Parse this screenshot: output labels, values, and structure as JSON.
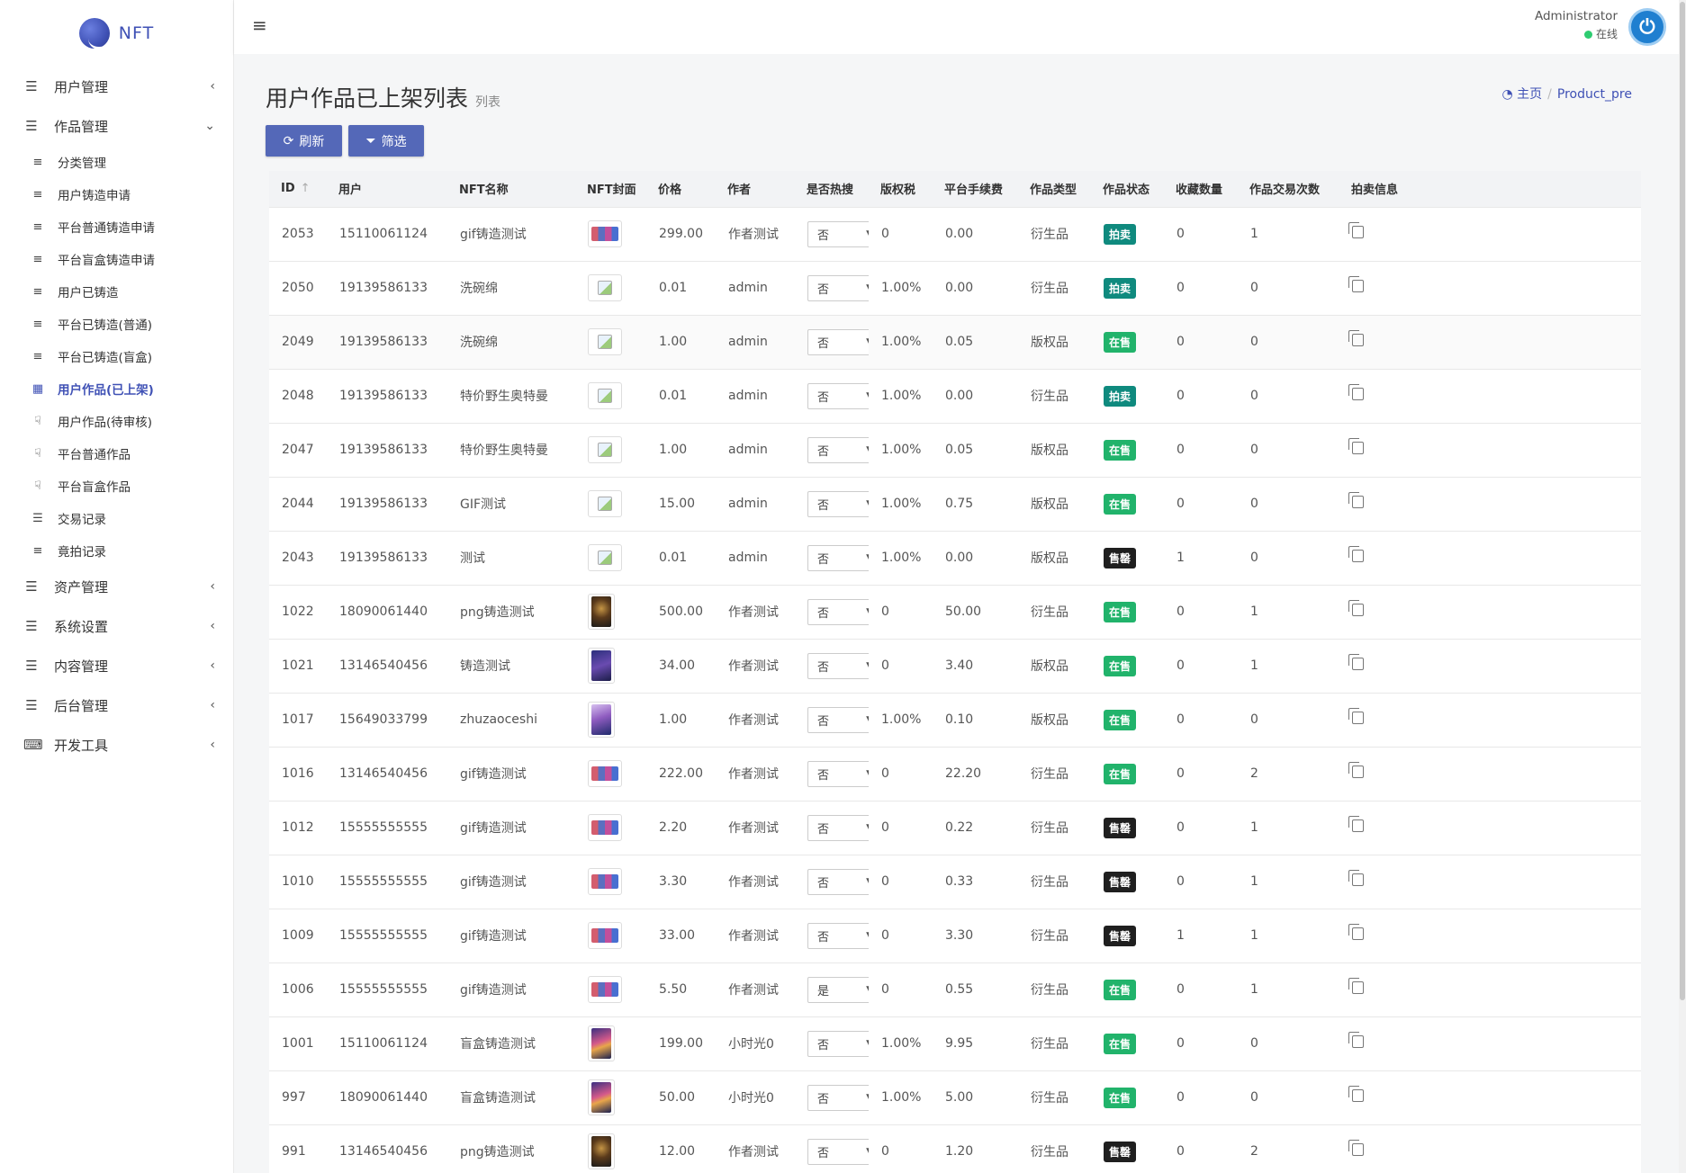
{
  "app": {
    "logo_text": "NFT"
  },
  "sidebar": {
    "groups_top": [
      {
        "label": "用户管理",
        "icon": "list-icon",
        "chevron": "‹"
      },
      {
        "label": "作品管理",
        "icon": "list-icon",
        "chevron": "⌄"
      }
    ],
    "sub_items": [
      {
        "label": "分类管理",
        "icon": "align-left-icon"
      },
      {
        "label": "用户铸造申请",
        "icon": "align-left-icon"
      },
      {
        "label": "平台普通铸造申请",
        "icon": "align-left-icon"
      },
      {
        "label": "平台盲盒铸造申请",
        "icon": "align-left-icon"
      },
      {
        "label": "用户已铸造",
        "icon": "align-left-icon"
      },
      {
        "label": "平台已铸造(普通)",
        "icon": "align-left-icon"
      },
      {
        "label": "平台已铸造(盲盒)",
        "icon": "align-left-icon"
      },
      {
        "label": "用户作品(已上架)",
        "icon": "grid-icon",
        "active": true
      },
      {
        "label": "用户作品(待审核)",
        "icon": "hand-icon"
      },
      {
        "label": "平台普通作品",
        "icon": "hand-icon"
      },
      {
        "label": "平台盲盒作品",
        "icon": "hand-icon"
      },
      {
        "label": "交易记录",
        "icon": "list-icon"
      },
      {
        "label": "竟拍记录",
        "icon": "align-left-icon"
      }
    ],
    "groups_bottom": [
      {
        "label": "资产管理",
        "icon": "list-icon",
        "chevron": "‹"
      },
      {
        "label": "系统设置",
        "icon": "list-icon",
        "chevron": "‹"
      },
      {
        "label": "内容管理",
        "icon": "list-icon",
        "chevron": "‹"
      },
      {
        "label": "后台管理",
        "icon": "list-icon",
        "chevron": "‹"
      },
      {
        "label": "开发工具",
        "icon": "keyboard-icon",
        "chevron": "‹"
      }
    ]
  },
  "header": {
    "user_name": "Administrator",
    "user_status": "在线"
  },
  "page": {
    "title": "用户作品已上架列表",
    "subtitle": "列表",
    "breadcrumb_home": "主页",
    "breadcrumb_sep": "/",
    "breadcrumb_current": "Product_pre"
  },
  "toolbar": {
    "refresh_label": "刷新",
    "filter_label": "筛选"
  },
  "table": {
    "columns": [
      "ID",
      "用户",
      "NFT名称",
      "NFT封面",
      "价格",
      "作者",
      "是否热搜",
      "版权税",
      "平台手续费",
      "作品类型",
      "作品状态",
      "收藏数量",
      "作品交易次数",
      "拍卖信息"
    ],
    "rows": [
      {
        "id": "2053",
        "user": "15110061124",
        "name": "gif铸造测试",
        "cover": "gif",
        "price": "299.00",
        "author": "作者测试",
        "hot": "否",
        "royalty": "0",
        "fee": "0.00",
        "type": "衍生品",
        "status": "拍卖",
        "fav": "0",
        "trades": "1"
      },
      {
        "id": "2050",
        "user": "19139586133",
        "name": "洗碗绵",
        "cover": "broken",
        "price": "0.01",
        "author": "admin",
        "hot": "否",
        "royalty": "1.00%",
        "fee": "0.00",
        "type": "衍生品",
        "status": "拍卖",
        "fav": "0",
        "trades": "0"
      },
      {
        "id": "2049",
        "user": "19139586133",
        "name": "洗碗绵",
        "cover": "broken",
        "price": "1.00",
        "author": "admin",
        "hot": "否",
        "royalty": "1.00%",
        "fee": "0.05",
        "type": "版权品",
        "status": "在售",
        "fav": "0",
        "trades": "0"
      },
      {
        "id": "2048",
        "user": "19139586133",
        "name": "特价野生奥特曼",
        "cover": "broken",
        "price": "0.01",
        "author": "admin",
        "hot": "否",
        "royalty": "1.00%",
        "fee": "0.00",
        "type": "衍生品",
        "status": "拍卖",
        "fav": "0",
        "trades": "0"
      },
      {
        "id": "2047",
        "user": "19139586133",
        "name": "特价野生奥特曼",
        "cover": "broken",
        "price": "1.00",
        "author": "admin",
        "hot": "否",
        "royalty": "1.00%",
        "fee": "0.05",
        "type": "版权品",
        "status": "在售",
        "fav": "0",
        "trades": "0"
      },
      {
        "id": "2044",
        "user": "19139586133",
        "name": "GIF测试",
        "cover": "broken",
        "price": "15.00",
        "author": "admin",
        "hot": "否",
        "royalty": "1.00%",
        "fee": "0.75",
        "type": "版权品",
        "status": "在售",
        "fav": "0",
        "trades": "0"
      },
      {
        "id": "2043",
        "user": "19139586133",
        "name": "测试",
        "cover": "broken",
        "price": "0.01",
        "author": "admin",
        "hot": "否",
        "royalty": "1.00%",
        "fee": "0.00",
        "type": "版权品",
        "status": "售罄",
        "fav": "1",
        "trades": "0"
      },
      {
        "id": "1022",
        "user": "18090061440",
        "name": "png铸造测试",
        "cover": "p-png",
        "price": "500.00",
        "author": "作者测试",
        "hot": "否",
        "royalty": "0",
        "fee": "50.00",
        "type": "衍生品",
        "status": "在售",
        "fav": "0",
        "trades": "1"
      },
      {
        "id": "1021",
        "user": "13146540456",
        "name": "铸造测试",
        "cover": "p-cast",
        "price": "34.00",
        "author": "作者测试",
        "hot": "否",
        "royalty": "0",
        "fee": "3.40",
        "type": "版权品",
        "status": "在售",
        "fav": "0",
        "trades": "1"
      },
      {
        "id": "1017",
        "user": "15649033799",
        "name": "zhuzaoceshi",
        "cover": "p-zz",
        "price": "1.00",
        "author": "作者测试",
        "hot": "否",
        "royalty": "1.00%",
        "fee": "0.10",
        "type": "版权品",
        "status": "在售",
        "fav": "0",
        "trades": "0"
      },
      {
        "id": "1016",
        "user": "13146540456",
        "name": "gif铸造测试",
        "cover": "gif",
        "price": "222.00",
        "author": "作者测试",
        "hot": "否",
        "royalty": "0",
        "fee": "22.20",
        "type": "衍生品",
        "status": "在售",
        "fav": "0",
        "trades": "2"
      },
      {
        "id": "1012",
        "user": "15555555555",
        "name": "gif铸造测试",
        "cover": "gif",
        "price": "2.20",
        "author": "作者测试",
        "hot": "否",
        "royalty": "0",
        "fee": "0.22",
        "type": "衍生品",
        "status": "售罄",
        "fav": "0",
        "trades": "1"
      },
      {
        "id": "1010",
        "user": "15555555555",
        "name": "gif铸造测试",
        "cover": "gif",
        "price": "3.30",
        "author": "作者测试",
        "hot": "否",
        "royalty": "0",
        "fee": "0.33",
        "type": "衍生品",
        "status": "售罄",
        "fav": "0",
        "trades": "1"
      },
      {
        "id": "1009",
        "user": "15555555555",
        "name": "gif铸造测试",
        "cover": "gif",
        "price": "33.00",
        "author": "作者测试",
        "hot": "否",
        "royalty": "0",
        "fee": "3.30",
        "type": "衍生品",
        "status": "售罄",
        "fav": "1",
        "trades": "1"
      },
      {
        "id": "1006",
        "user": "15555555555",
        "name": "gif铸造测试",
        "cover": "gif",
        "price": "5.50",
        "author": "作者测试",
        "hot": "是",
        "royalty": "0",
        "fee": "0.55",
        "type": "衍生品",
        "status": "在售",
        "fav": "0",
        "trades": "1"
      },
      {
        "id": "1001",
        "user": "15110061124",
        "name": "盲盒铸造测试",
        "cover": "p-blind",
        "price": "199.00",
        "author": "小时光0",
        "hot": "否",
        "royalty": "1.00%",
        "fee": "9.95",
        "type": "衍生品",
        "status": "在售",
        "fav": "0",
        "trades": "0"
      },
      {
        "id": "997",
        "user": "18090061440",
        "name": "盲盒铸造测试",
        "cover": "p-blind",
        "price": "50.00",
        "author": "小时光0",
        "hot": "否",
        "royalty": "1.00%",
        "fee": "5.00",
        "type": "衍生品",
        "status": "在售",
        "fav": "0",
        "trades": "0"
      },
      {
        "id": "991",
        "user": "13146540456",
        "name": "png铸造测试",
        "cover": "p-png",
        "price": "12.00",
        "author": "作者测试",
        "hot": "否",
        "royalty": "0",
        "fee": "1.20",
        "type": "衍生品",
        "status": "售罄",
        "fav": "0",
        "trades": "2"
      }
    ]
  },
  "status_colors": {
    "拍卖": "#0f8a7e",
    "在售": "#21b36b",
    "售罄": "#1f1f1f"
  },
  "colors": {
    "accent": "#3f51b5",
    "button": "#5468b8"
  }
}
